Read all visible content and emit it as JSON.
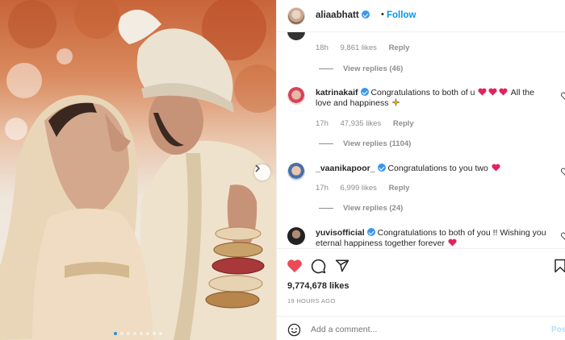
{
  "post": {
    "author": "aliaabhatt",
    "separator": "•",
    "follow_label": "Follow",
    "likes": "9,774,678 likes",
    "timestamp": "19 HOURS AGO",
    "comment_placeholder": "Add a comment...",
    "post_label": "Post",
    "carousel": {
      "total": 8,
      "active": 1
    }
  },
  "comments": [
    {
      "meta_time": "18h",
      "meta_likes": "9,861 likes",
      "reply_label": "Reply",
      "view_replies": "View replies (46)"
    },
    {
      "user": "katrinakaif",
      "verified": true,
      "text_a": "Congratulations to both of u",
      "text_b": "All the love and happiness",
      "meta_time": "17h",
      "meta_likes": "47,935 likes",
      "reply_label": "Reply",
      "view_replies": "View replies (1104)"
    },
    {
      "user": "_vaanikapoor_",
      "verified": true,
      "text_a": "Congratulations to you two",
      "meta_time": "17h",
      "meta_likes": "6,999 likes",
      "reply_label": "Reply",
      "view_replies": "View replies (24)"
    },
    {
      "user": "yuvisofficial",
      "verified": true,
      "text_a": "Congratulations to both of you !! Wishing you eternal happiness together forever"
    }
  ],
  "icons": {
    "heart": "heart-filled-icon",
    "comment": "comment-icon",
    "share": "share-icon",
    "save": "bookmark-icon",
    "emoji": "smiley-icon",
    "next": "chevron-right-icon"
  },
  "colors": {
    "accent": "#0095f6",
    "heart": "#ed4956",
    "verified": "#3897f0"
  }
}
